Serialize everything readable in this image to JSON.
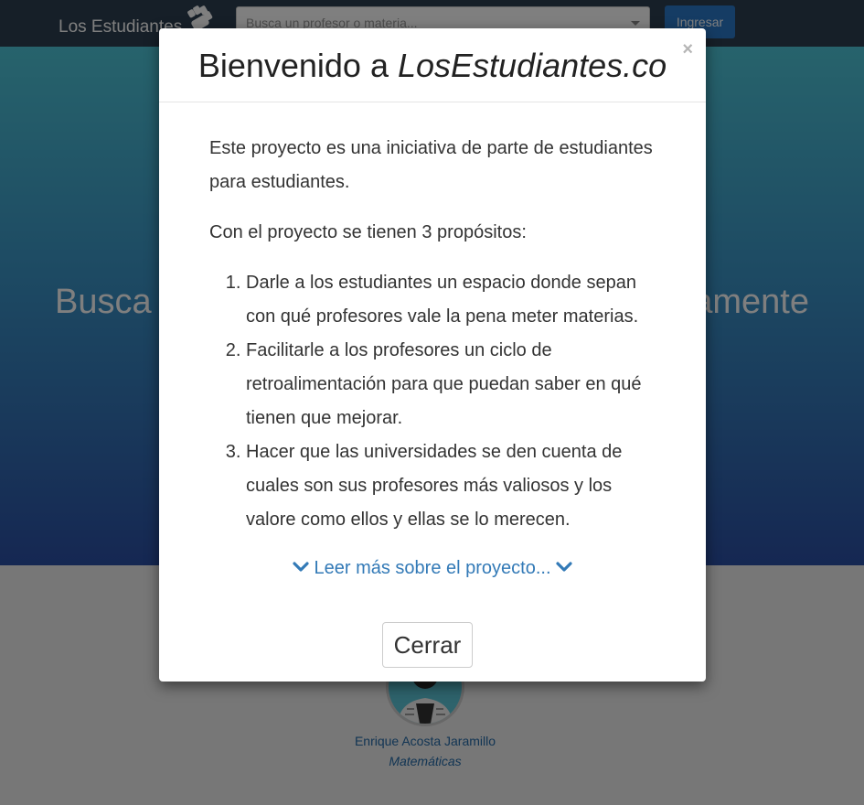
{
  "navbar": {
    "brand": "Los Estudiantes",
    "search_placeholder": "Busca un profesor o materia...",
    "login_label": "Ingresar"
  },
  "hero": {
    "text_left": "Busca y",
    "text_right": "amente"
  },
  "professor": {
    "name": "Enrique Acosta Jaramillo",
    "subject": "Matemáticas"
  },
  "modal": {
    "title_plain": "Bienvenido a ",
    "title_brand": "LosEstudiantes.co",
    "close_symbol": "×",
    "intro": "Este proyecto es una iniciativa de parte de estudiantes para estudiantes.",
    "purposes_heading": "Con el proyecto se tienen 3 propósitos:",
    "purposes": [
      "Darle a los estudiantes un espacio donde sepan con qué profesores vale la pena meter materias.",
      "Facilitarle a los profesores un ciclo de retroalimentación para que puedan saber en qué tienen que mejorar.",
      "Hacer que las universidades se den cuenta de cuales son sus profesores más valiosos y los valore como ellos y ellas se lo merecen."
    ],
    "read_more": "Leer más sobre el proyecto...",
    "close_button": "Cerrar"
  },
  "colors": {
    "navbar": "#2c3e50",
    "accent": "#2a78c8",
    "link": "#337ab7"
  },
  "icons": [
    "fist-logo-icon",
    "chevron-down-icon"
  ]
}
